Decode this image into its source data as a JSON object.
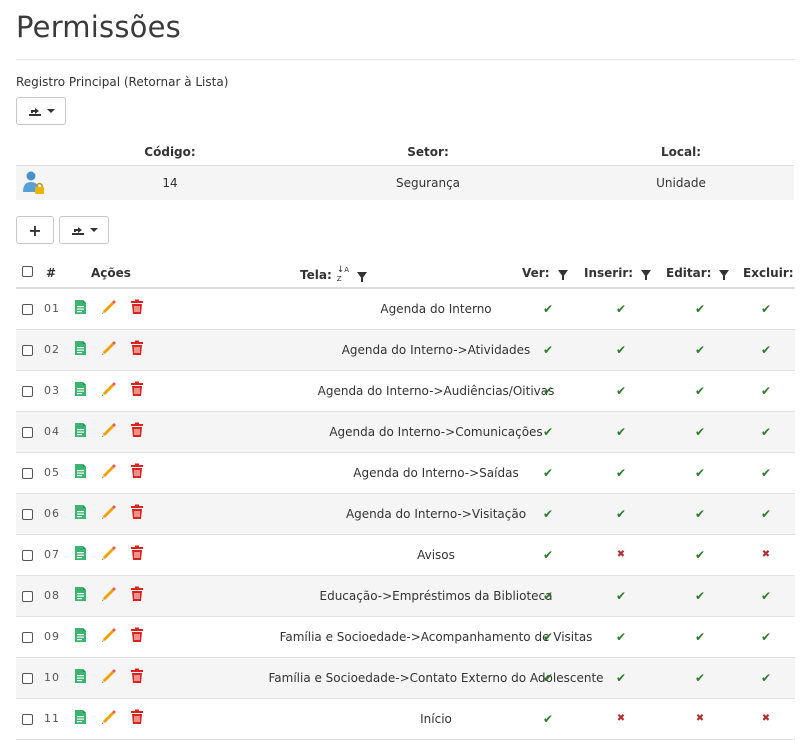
{
  "page": {
    "title": "Permissões"
  },
  "breadcrumb": {
    "prefix": "Registro Principal (",
    "link": "Retornar à Lista",
    "suffix": ")"
  },
  "toolbar": {
    "add_label": "+"
  },
  "record": {
    "headers": {
      "codigo": "Código:",
      "setor": "Setor:",
      "local": "Local:"
    },
    "values": {
      "codigo": "14",
      "setor": "Segurança",
      "local": "Unidade"
    },
    "icon": "user-lock-icon"
  },
  "table": {
    "headers": {
      "num": "#",
      "acoes": "Ações",
      "tela": "Tela:",
      "ver": "Ver:",
      "inserir": "Inserir:",
      "editar": "Editar:",
      "excluir": "Excluir:"
    },
    "sort_icon": "sort-alpha-icon",
    "rows": [
      {
        "num": "01",
        "tela": "Agenda do Interno",
        "ver": true,
        "inserir": true,
        "editar": true,
        "excluir": true
      },
      {
        "num": "02",
        "tela": "Agenda do Interno->Atividades",
        "ver": true,
        "inserir": true,
        "editar": true,
        "excluir": true
      },
      {
        "num": "03",
        "tela": "Agenda do Interno->Audiências/Oitivas",
        "ver": true,
        "inserir": true,
        "editar": true,
        "excluir": true
      },
      {
        "num": "04",
        "tela": "Agenda do Interno->Comunicações",
        "ver": true,
        "inserir": true,
        "editar": true,
        "excluir": true
      },
      {
        "num": "05",
        "tela": "Agenda do Interno->Saídas",
        "ver": true,
        "inserir": true,
        "editar": true,
        "excluir": true
      },
      {
        "num": "06",
        "tela": "Agenda do Interno->Visitação",
        "ver": true,
        "inserir": true,
        "editar": true,
        "excluir": true
      },
      {
        "num": "07",
        "tela": "Avisos",
        "ver": true,
        "inserir": false,
        "editar": true,
        "excluir": false
      },
      {
        "num": "08",
        "tela": "Educação->Empréstimos da Biblioteca",
        "ver": true,
        "inserir": true,
        "editar": true,
        "excluir": true
      },
      {
        "num": "09",
        "tela": "Família e Socioedade->Acompanhamento de Visitas",
        "ver": true,
        "inserir": true,
        "editar": true,
        "excluir": true
      },
      {
        "num": "10",
        "tela": "Família e Socioedade->Contato Externo do Adolescente",
        "ver": true,
        "inserir": true,
        "editar": true,
        "excluir": true
      },
      {
        "num": "11",
        "tela": "Início",
        "ver": true,
        "inserir": false,
        "editar": false,
        "excluir": false
      }
    ]
  },
  "glyphs": {
    "yes": "✔",
    "no": "✖"
  },
  "colors": {
    "yes": "#2d7a2d",
    "no": "#b03030",
    "view": "#3cb371",
    "edit": "#f0a000",
    "delete": "#d9231e"
  }
}
